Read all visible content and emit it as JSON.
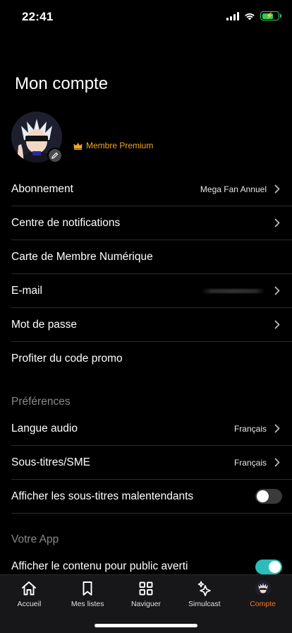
{
  "status": {
    "time": "22:41"
  },
  "page": {
    "title": "Mon compte"
  },
  "profile": {
    "badge": "Membre Premium"
  },
  "account_rows": [
    {
      "label": "Abonnement",
      "value": "Mega Fan Annuel"
    },
    {
      "label": "Centre de notifications"
    },
    {
      "label": "Carte de Membre Numérique"
    },
    {
      "label": "E-mail"
    },
    {
      "label": "Mot de passe"
    },
    {
      "label": "Profiter du code promo"
    }
  ],
  "preferences": {
    "header": "Préférences",
    "rows": [
      {
        "label": "Langue audio",
        "value": "Français"
      },
      {
        "label": "Sous-titres/SME",
        "value": "Français"
      },
      {
        "label": "Afficher les sous-titres malentendants",
        "toggle": false
      }
    ]
  },
  "app": {
    "header": "Votre App",
    "rows": [
      {
        "label": "Afficher le contenu pour public averti",
        "toggle": true
      }
    ]
  },
  "tabs": [
    {
      "label": "Accueil",
      "icon": "home-icon"
    },
    {
      "label": "Mes listes",
      "icon": "bookmark-icon"
    },
    {
      "label": "Naviguer",
      "icon": "grid-icon"
    },
    {
      "label": "Simulcast",
      "icon": "sparkle-icon"
    },
    {
      "label": "Compte",
      "icon": "avatar-icon",
      "active": true
    }
  ],
  "colors": {
    "accent": "#f47521",
    "premium": "#f6a623",
    "toggle_on": "#2abdbb"
  }
}
